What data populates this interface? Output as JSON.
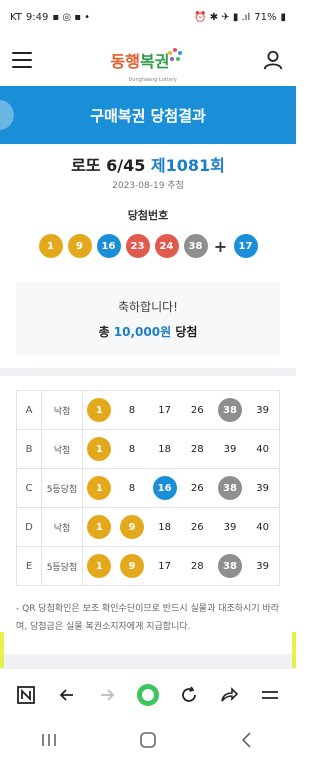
{
  "status_bar": {
    "carrier": "KT",
    "time": "9:49",
    "battery": "71%"
  },
  "app": {
    "logo_text": "동행복권",
    "logo_sub": "Donghaeng Lottery"
  },
  "banner": {
    "title": "구매복권 당첨결과"
  },
  "draw": {
    "game": "로또 6/45",
    "round": "제1081회",
    "date": "2023-08-19 추첨"
  },
  "winning": {
    "label": "당첨번호",
    "numbers": [
      1,
      9,
      16,
      23,
      24,
      38
    ],
    "bonus": 17,
    "plus": "+"
  },
  "result": {
    "congrats": "축하합니다!",
    "prize_prefix": "총",
    "prize_amount": "10,000원",
    "prize_suffix": "당첨"
  },
  "tickets": [
    {
      "letter": "A",
      "result": "낙첨",
      "numbers": [
        1,
        8,
        17,
        26,
        38,
        39
      ]
    },
    {
      "letter": "B",
      "result": "낙첨",
      "numbers": [
        1,
        8,
        18,
        28,
        39,
        40
      ]
    },
    {
      "letter": "C",
      "result": "5등당첨",
      "numbers": [
        1,
        8,
        16,
        26,
        38,
        39
      ]
    },
    {
      "letter": "D",
      "result": "낙첨",
      "numbers": [
        1,
        9,
        18,
        26,
        39,
        40
      ]
    },
    {
      "letter": "E",
      "result": "5등당첨",
      "numbers": [
        1,
        9,
        17,
        28,
        38,
        39
      ]
    }
  ],
  "note": "- QR 당첨확인은 보조 확인수단이므로 반드시 실물과 대조하시기 바라며, 당첨금은 실물 복권소지자에게 지급합니다.",
  "colors": {
    "yellow": "#e3a81c",
    "blue": "#1a8fd8",
    "red": "#e15a4e",
    "gray": "#8f8f8f",
    "green": "#3cc55a",
    "accent": "#1a7fc8"
  },
  "toolbar_icons": [
    "n-icon",
    "back-icon",
    "forward-icon",
    "home-circle-icon",
    "refresh-icon",
    "share-icon",
    "menu-icon"
  ],
  "nav_icons": [
    "recents-icon",
    "home-icon",
    "back-icon"
  ]
}
